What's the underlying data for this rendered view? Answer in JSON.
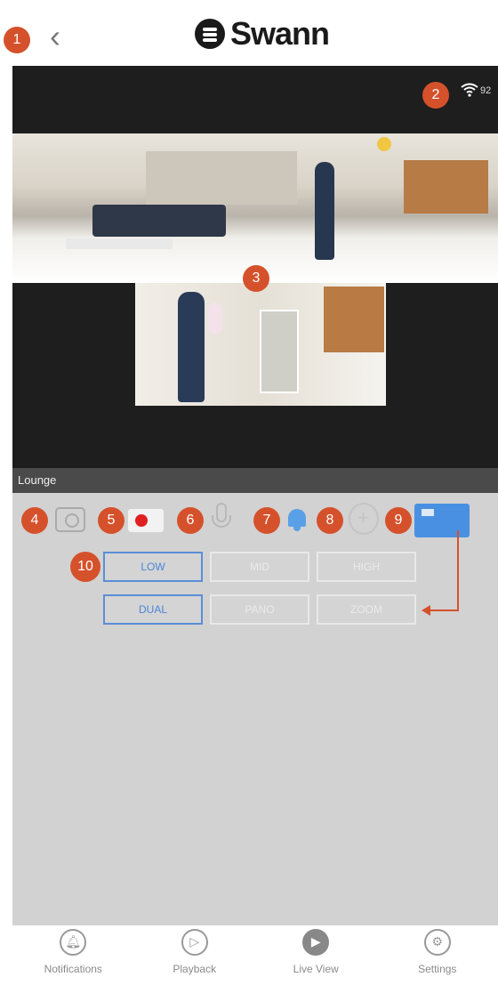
{
  "header": {
    "back_glyph": "‹",
    "logo_text": "Swann"
  },
  "status": {
    "signal_value": "92"
  },
  "camera": {
    "name": "Lounge"
  },
  "badges": [
    "1",
    "2",
    "3",
    "4",
    "5",
    "6",
    "7",
    "8",
    "9",
    "10"
  ],
  "toolbar": {
    "snapshot_icon": "camera-icon",
    "record_icon": "record-icon",
    "talk_icon": "microphone-icon",
    "alarm_icon": "bell-icon",
    "ptz_icon": "ptz-icon",
    "quality_icon": "stream-quality-icon"
  },
  "quality_options": [
    "LOW",
    "MID",
    "HIGH"
  ],
  "view_options": [
    "DUAL",
    "PANO",
    "ZOOM"
  ],
  "selected": {
    "quality": "LOW",
    "view": "DUAL"
  },
  "nav": {
    "tabs": [
      {
        "label": "Notifications",
        "icon": "bell-icon"
      },
      {
        "label": "Playback",
        "icon": "play-icon"
      },
      {
        "label": "Live View",
        "icon": "live-view-icon"
      },
      {
        "label": "Settings",
        "icon": "gear-icon"
      }
    ]
  },
  "colors": {
    "accent": "#4a90e2",
    "badge": "#d5512b",
    "record": "#e02020"
  }
}
